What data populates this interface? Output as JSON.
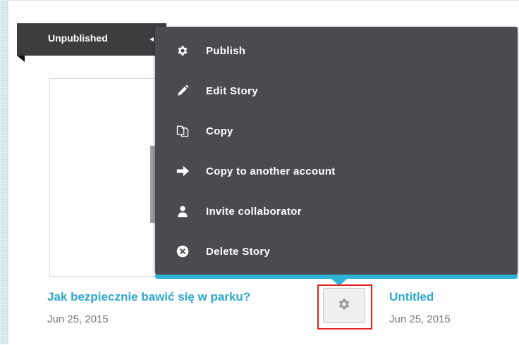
{
  "status_label": "Unpublished",
  "menu": {
    "items": [
      {
        "label": "Publish",
        "icon": "gear-icon"
      },
      {
        "label": "Edit Story",
        "icon": "pencil-icon"
      },
      {
        "label": "Copy",
        "icon": "copy-icon"
      },
      {
        "label": "Copy to another account",
        "icon": "arrow-right-icon"
      },
      {
        "label": "Invite collaborator",
        "icon": "user-icon"
      },
      {
        "label": "Delete Story",
        "icon": "close-circle-icon"
      }
    ]
  },
  "stories": [
    {
      "title": "Jak bezpiecznie bawić się w parku?",
      "date": "Jun 25, 2015"
    },
    {
      "title": "Untitled",
      "date": "Jun 25, 2015"
    }
  ],
  "colors": {
    "menu_bg": "#4a4b4f",
    "accent": "#2fb3d6",
    "title_link": "#2ea8cf",
    "highlight": "#e0211f"
  }
}
